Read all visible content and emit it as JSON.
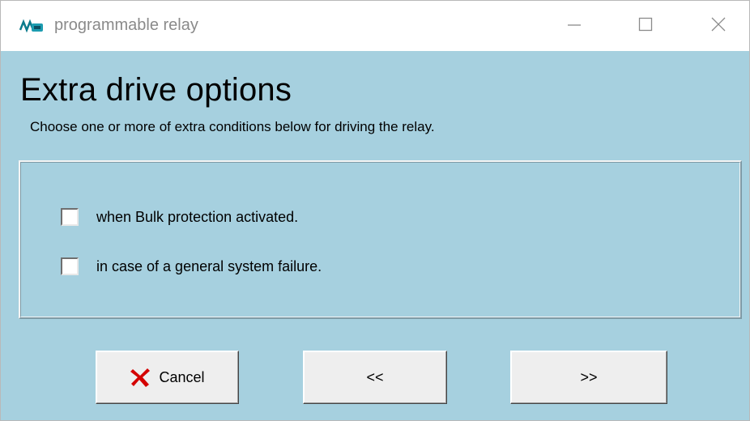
{
  "window": {
    "title": "programmable relay",
    "icon": "relay-app-icon",
    "controls": {
      "minimize_icon": "minimize-icon",
      "maximize_icon": "maximize-icon",
      "close_icon": "close-icon"
    }
  },
  "page": {
    "heading": "Extra drive options",
    "subheading": "Choose one or more of extra conditions below for driving the relay."
  },
  "options": [
    {
      "label": "when Bulk protection activated.",
      "checked": false
    },
    {
      "label": "in case of a general system failure.",
      "checked": false
    }
  ],
  "buttons": {
    "cancel_label": "Cancel",
    "cancel_icon": "red-x-icon",
    "back_label": "<<",
    "next_label": ">>"
  },
  "colors": {
    "background": "#a6d0df",
    "cancel_icon": "#d40000"
  }
}
